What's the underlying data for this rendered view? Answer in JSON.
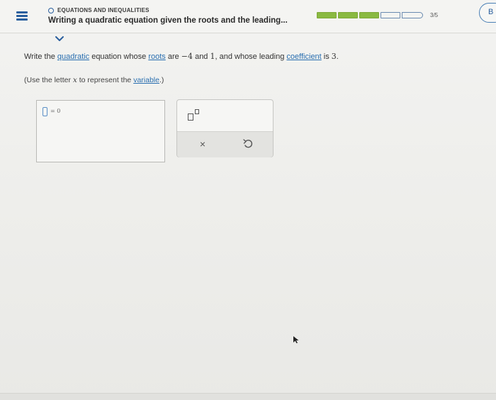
{
  "header": {
    "topic": "EQUATIONS AND INEQUALITIES",
    "lesson_title": "Writing a quadratic equation given the roots and the leading...",
    "progress": {
      "text": "3/5",
      "segments": [
        {
          "state": "done"
        },
        {
          "state": "done"
        },
        {
          "state": "done"
        },
        {
          "state": "empty"
        },
        {
          "state": "empty"
        }
      ]
    },
    "avatar_initial": "B"
  },
  "question": {
    "part1": "Write the ",
    "link_quadratic": "quadratic",
    "part2": " equation whose ",
    "link_roots": "roots",
    "part3": " are ",
    "root1": "−4",
    "part4": " and ",
    "root2": "1",
    "part5": ", and whose leading ",
    "link_coefficient": "coefficient",
    "part6": " is ",
    "coefficient_value": "3",
    "part7": "."
  },
  "hint": {
    "part1": "(Use the letter ",
    "letter": "x",
    "part2": " to represent the ",
    "link_variable": "variable",
    "part3": ".)"
  },
  "answer": {
    "equation_suffix": "= 0"
  },
  "keypad": {
    "clear_symbol": "×"
  },
  "colors": {
    "accent": "#2a5f9e",
    "link": "#2a6fb0",
    "progress_done": "#8ab941"
  },
  "icons": {
    "menu": "hamburger-icon",
    "chevron": "chevron-down-icon",
    "exponent": "exponent-icon",
    "clear": "close-icon",
    "undo": "undo-icon"
  }
}
